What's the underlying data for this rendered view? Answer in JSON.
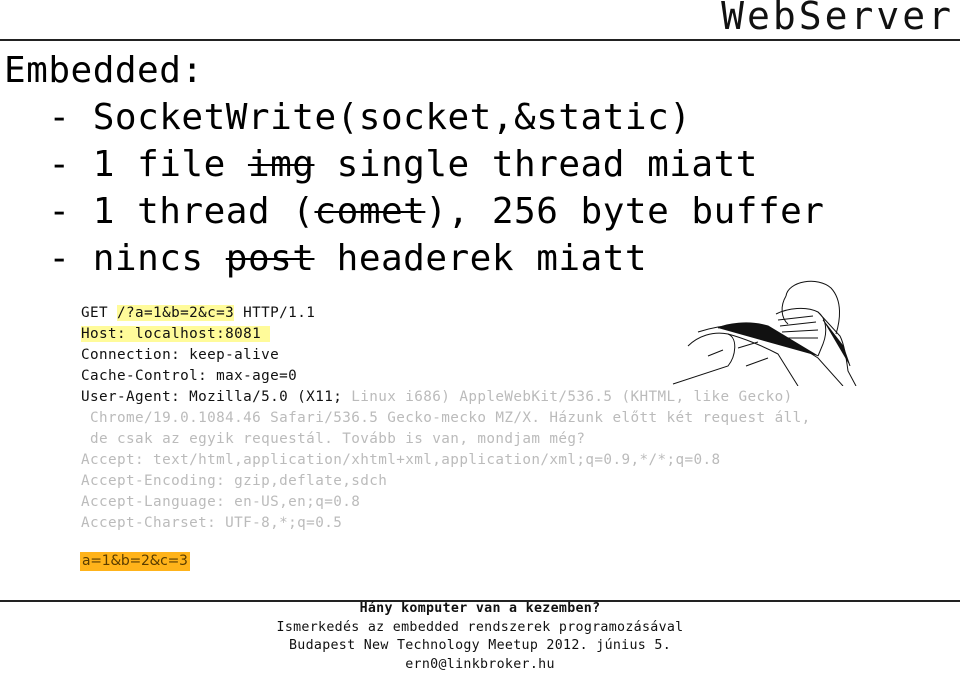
{
  "slide": {
    "title": "WebServer",
    "bullets": {
      "heading": "Embedded:",
      "items": [
        {
          "prefix": "- ",
          "parts": [
            {
              "text": "SocketWrite(socket,&static)",
              "strike": false
            }
          ]
        },
        {
          "prefix": "- ",
          "parts": [
            {
              "text": "1 file ",
              "strike": false
            },
            {
              "text": "img",
              "strike": true
            },
            {
              "text": " single thread miatt",
              "strike": false
            }
          ]
        },
        {
          "prefix": "- ",
          "parts": [
            {
              "text": "1 thread (",
              "strike": false
            },
            {
              "text": "comet",
              "strike": true
            },
            {
              "text": "), 256 byte buffer",
              "strike": false
            }
          ]
        },
        {
          "prefix": "- ",
          "parts": [
            {
              "text": "nincs ",
              "strike": false
            },
            {
              "text": "post",
              "strike": true
            },
            {
              "text": " headerek miatt",
              "strike": false
            }
          ]
        }
      ]
    },
    "request": {
      "line1_method": "GET ",
      "line1_query": "/?a=1&b=2&c=3",
      "line1_proto": " HTTP/1.1",
      "host": "Host: localhost:8081 ",
      "connection": "Connection: keep-alive",
      "cache_control": "Cache-Control: max-age=0",
      "user_agent_dark": "User-Agent: Mozilla/5.0 (X11;",
      "user_agent_gray": " Linux i686) AppleWebKit/536.5 (KHTML, like Gecko)",
      "user_agent_line2": " Chrome/19.0.1084.46 Safari/536.5 Gecko-mecko MZ/X. Házunk előtt két request áll,",
      "user_agent_line3": " de csak az egyik requestál. Tovább is van, mondjam még?",
      "accept": "Accept: text/html,application/xhtml+xml,application/xml;q=0.9,*/*;q=0.8",
      "accept_encoding": "Accept-Encoding: gzip,deflate,sdch",
      "accept_language": "Accept-Language: en-US,en;q=0.8",
      "accept_charset": "Accept-Charset: UTF-8,*;q=0.5",
      "body": "a=1&b=2&c=3"
    },
    "image": {
      "icon": "facepalm-illustration"
    },
    "footer": {
      "line1": "Hány komputer van a kezemben?",
      "line2": "Ismerkedés az embedded rendszerek programozásával",
      "line3": "Budapest New Technology Meetup 2012. június 5.",
      "line4": "ern0@linkbroker.hu"
    },
    "colors": {
      "highlight_yellow": "#fffb9a",
      "highlight_orange": "#ffb31a",
      "faded_text": "#bbbbbb"
    }
  }
}
